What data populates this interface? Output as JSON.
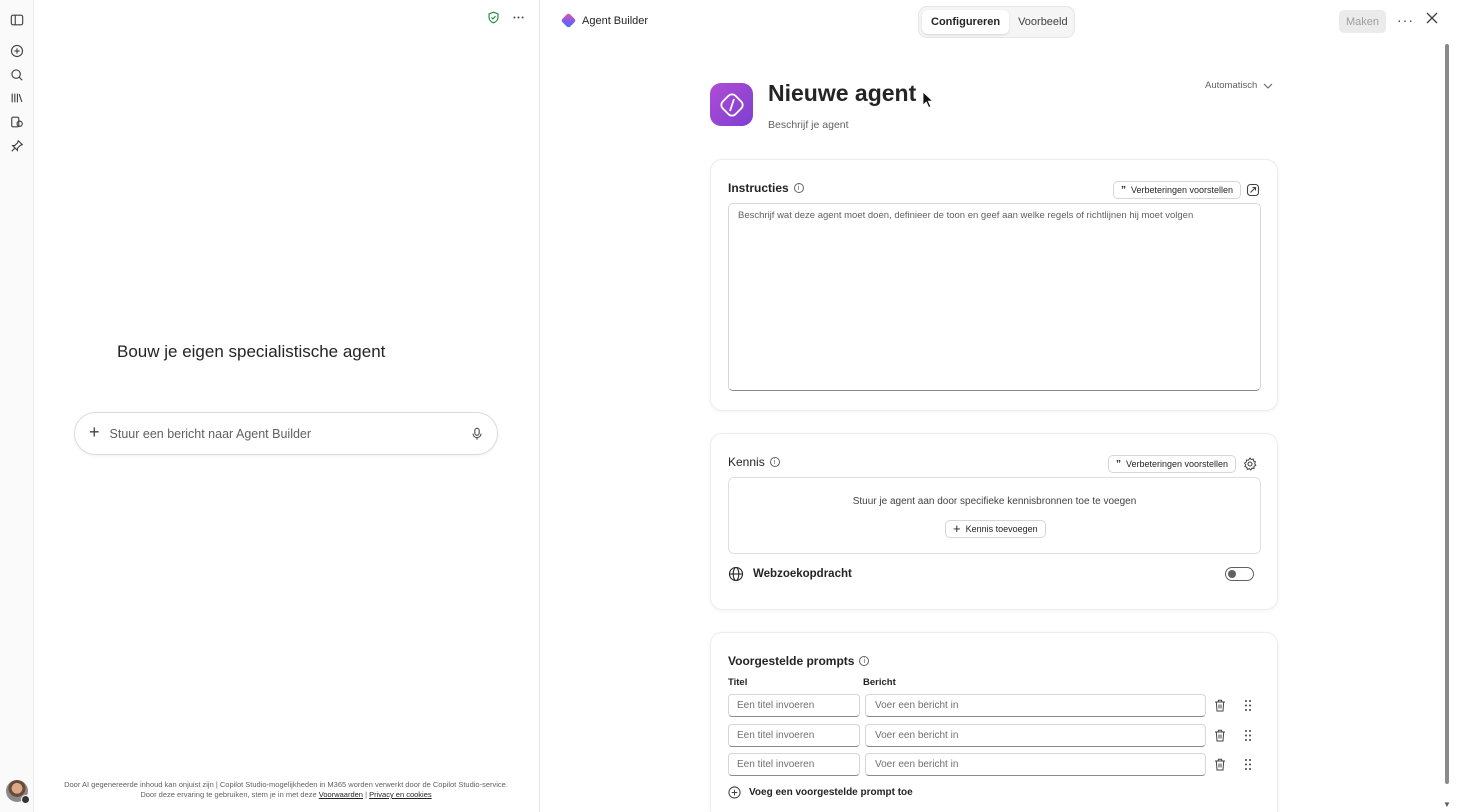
{
  "rail": {
    "icons": [
      "sidebar-toggle-icon",
      "new-chat-icon",
      "search-icon",
      "library-icon",
      "agents-icon",
      "pin-icon"
    ]
  },
  "chat": {
    "heading": "Bouw je eigen specialistische agent",
    "composer_placeholder": "Stuur een bericht naar Agent Builder",
    "disclaimer_text": "Door AI gegenereerde inhoud kan onjuist zijn | Copilot Studio-mogelijkheden in M365 worden verwerkt door de Copilot Studio-service. Door deze ervaring te gebruiken, stem je in met deze",
    "terms_link": "Voorwaarden",
    "privacy_link": "Privacy en cookies"
  },
  "header": {
    "app_name": "Agent Builder",
    "tabs": [
      {
        "label": "Configureren",
        "active": true
      },
      {
        "label": "Voorbeeld",
        "active": false
      }
    ],
    "create_label": "Maken"
  },
  "agent": {
    "title": "Nieuwe agent",
    "description": "Beschrijf je agent",
    "model_select": "Automatisch"
  },
  "instructions": {
    "title": "Instructies",
    "suggest_label": "Verbeteringen voorstellen",
    "placeholder": "Beschrijf wat deze agent moet doen, definieer de toon en geef aan welke regels of richtlijnen hij moet volgen"
  },
  "knowledge": {
    "title": "Kennis",
    "suggest_label": "Verbeteringen voorstellen",
    "empty_text": "Stuur je agent aan door specifieke kennisbronnen toe te voegen",
    "add_label": "Kennis toevoegen",
    "web_search_label": "Webzoekopdracht",
    "web_search_enabled": false
  },
  "prompts": {
    "title": "Voorgestelde prompts",
    "col_title": "Titel",
    "col_message": "Bericht",
    "rows": [
      {
        "title_placeholder": "Een titel invoeren",
        "message_placeholder": "Voer een bericht in"
      },
      {
        "title_placeholder": "Een titel invoeren",
        "message_placeholder": "Voer een bericht in"
      },
      {
        "title_placeholder": "Een titel invoeren",
        "message_placeholder": "Voer een bericht in"
      }
    ],
    "add_label": "Voeg een voorgestelde prompt toe"
  },
  "colors": {
    "accent_purple": "#8a43d4",
    "shield_green": "#1a8a3a"
  }
}
